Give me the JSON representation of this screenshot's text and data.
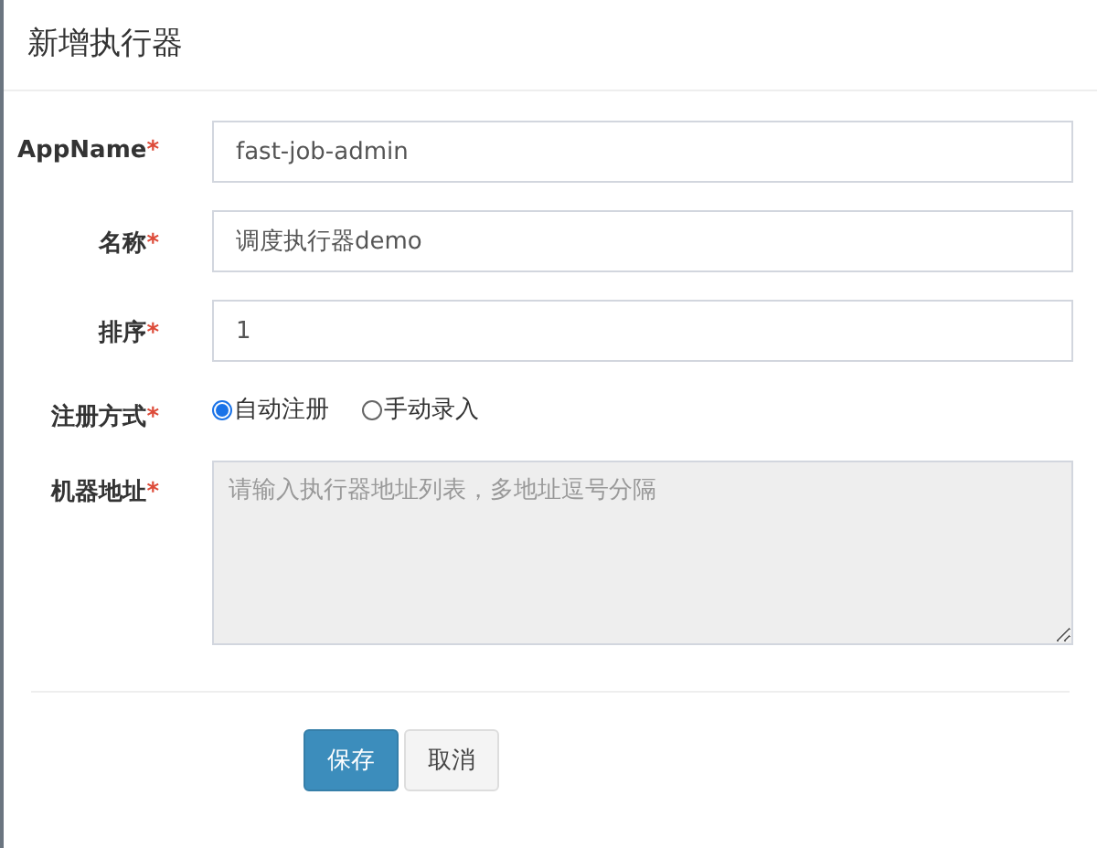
{
  "dialog": {
    "title": "新增执行器"
  },
  "fields": [
    {
      "kind": "input",
      "label": "AppName",
      "required_mark": "*",
      "value": "fast-job-admin"
    },
    {
      "kind": "input",
      "label": "名称",
      "required_mark": "*",
      "value": "调度执行器demo"
    },
    {
      "kind": "input",
      "label": "排序",
      "required_mark": "*",
      "value": "1"
    },
    {
      "kind": "radio",
      "label": "注册方式",
      "required_mark": "*",
      "options": [
        {
          "label": "自动注册",
          "selected": true
        },
        {
          "label": "手动录入",
          "selected": false
        }
      ]
    },
    {
      "kind": "textarea",
      "label": "机器地址",
      "required_mark": "*",
      "placeholder": "请输入执行器地址列表，多地址逗号分隔",
      "disabled": true
    }
  ],
  "buttons": [
    {
      "label": "保存",
      "kind": "primary"
    },
    {
      "label": "取消",
      "kind": "default"
    }
  ]
}
